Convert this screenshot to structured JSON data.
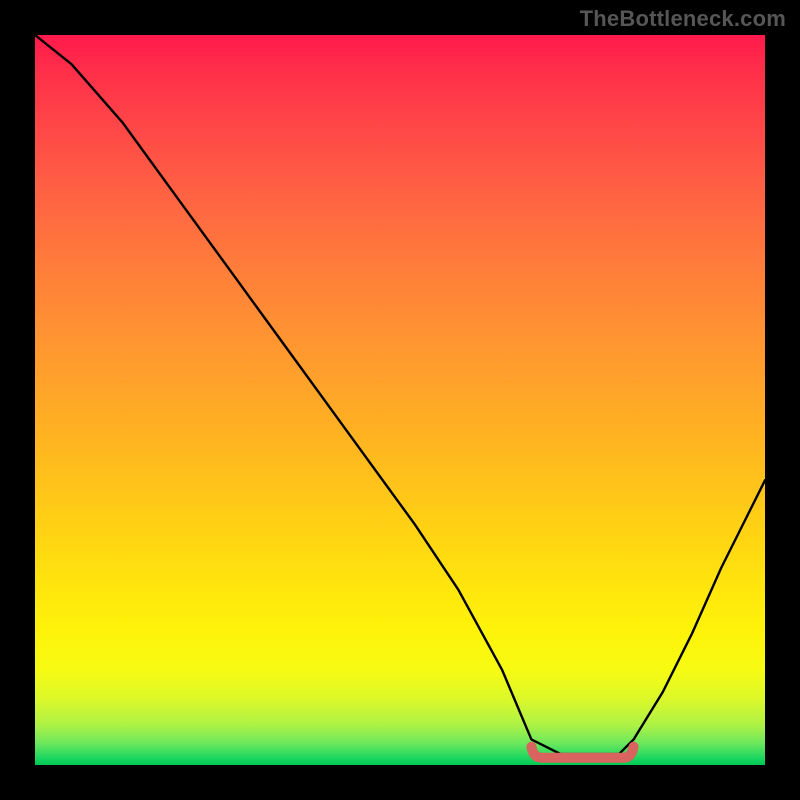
{
  "watermark": "TheBottleneck.com",
  "colors": {
    "curve": "#000000",
    "trough_highlight": "#d8635f",
    "gradient_top": "#ff1a4b",
    "gradient_bottom": "#00c853",
    "page_background": "#000000",
    "watermark_text": "#565656"
  },
  "chart_data": {
    "type": "line",
    "title": "",
    "xlabel": "",
    "ylabel": "",
    "xlim": [
      0,
      100
    ],
    "ylim": [
      0,
      100
    ],
    "legend": false,
    "grid": false,
    "trough": {
      "x_start": 68,
      "x_end": 82,
      "y": 1
    },
    "series": [
      {
        "name": "curve",
        "x": [
          0,
          5,
          12,
          20,
          28,
          36,
          44,
          52,
          58,
          64,
          68,
          72,
          76,
          80,
          82,
          86,
          90,
          94,
          97,
          100
        ],
        "values": [
          100,
          96,
          88,
          77,
          66,
          55,
          44,
          33,
          24,
          13,
          3.5,
          1.5,
          1.5,
          1.5,
          3.5,
          10,
          18,
          27,
          33,
          39
        ]
      }
    ]
  }
}
